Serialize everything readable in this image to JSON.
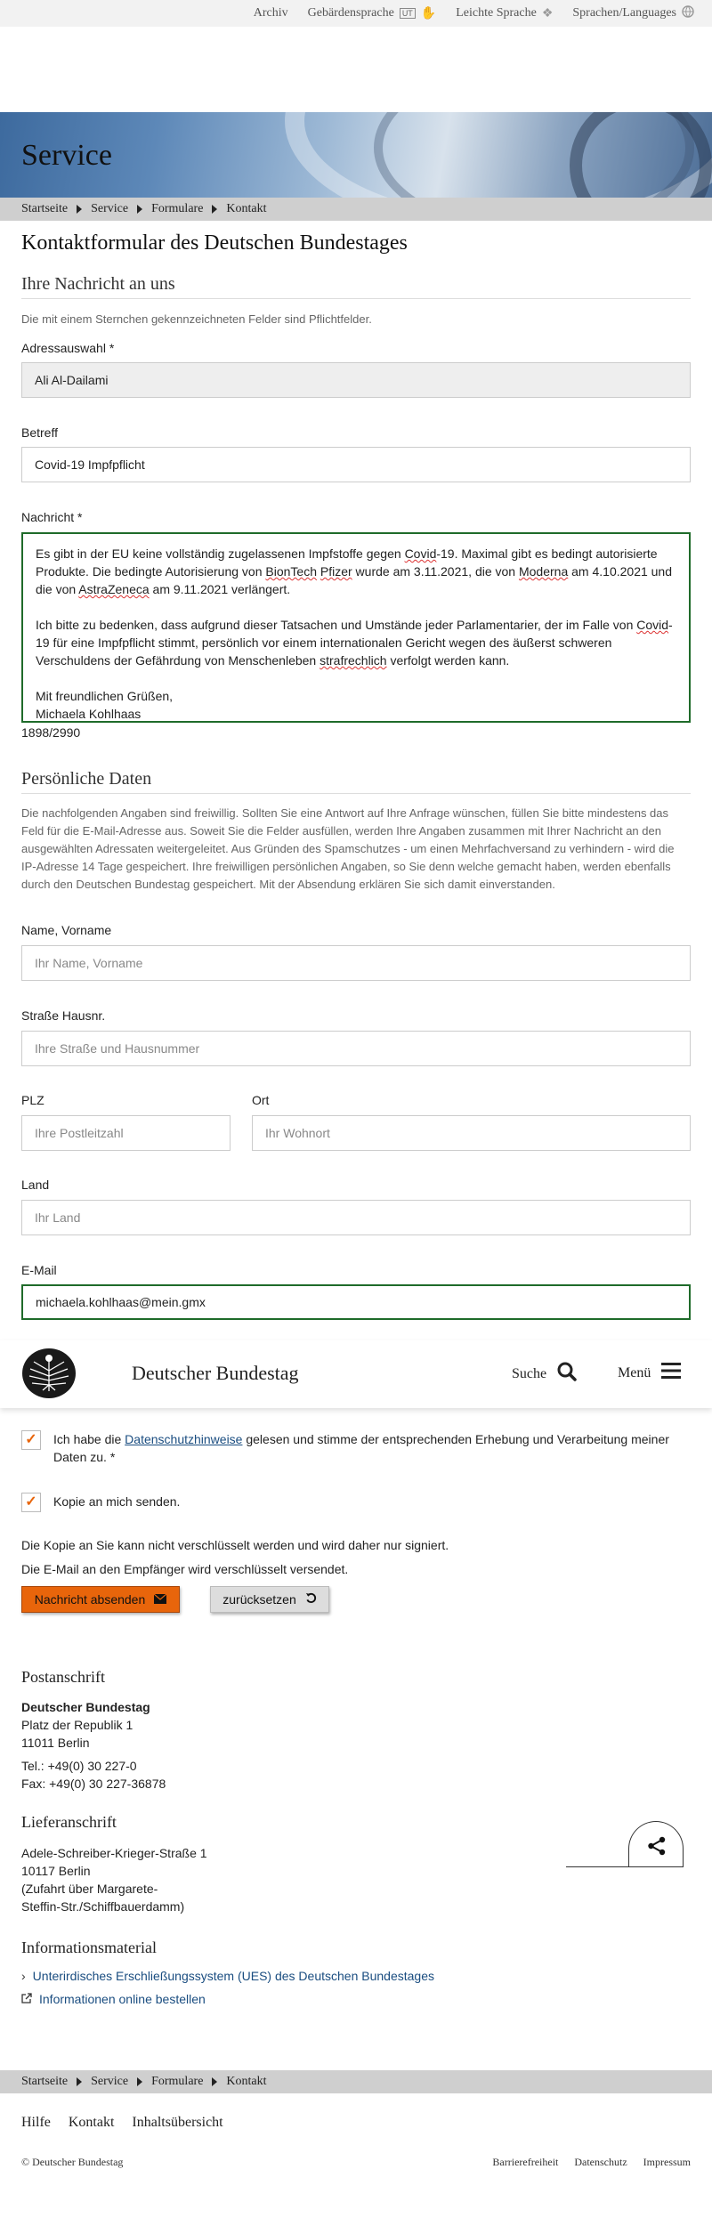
{
  "topbar": {
    "archiv": "Archiv",
    "gebaerdensprache": "Gebärdensprache",
    "gebaerden_badge": "UT",
    "leichte_sprache": "Leichte Sprache",
    "sprachen": "Sprachen/Languages"
  },
  "hero": {
    "title": "Service"
  },
  "breadcrumb": [
    "Startseite",
    "Service",
    "Formulare",
    "Kontakt"
  ],
  "page_title": "Kontaktformular des Deutschen Bundestages",
  "message_section": {
    "heading": "Ihre Nachricht an uns",
    "required_note": "Die mit einem Sternchen gekennzeichneten Felder sind Pflichtfelder.",
    "address_label": "Adressauswahl *",
    "address_value": "Ali Al-Dailami",
    "subject_label": "Betreff",
    "subject_value": "Covid-19 Impfpflicht",
    "message_label": "Nachricht *",
    "message_p1_a": "Es gibt in der EU keine vollständig zugelassenen Impfstoffe gegen ",
    "message_p1_b": "Covid",
    "message_p1_c": "-19. Maximal gibt es bedingt autorisierte Produkte. Die bedingte Autorisierung von ",
    "message_p1_d": "BionTech",
    "message_p1_e": " ",
    "message_p1_f": "Pfizer",
    "message_p1_g": " wurde am 3.11.2021, die von ",
    "message_p1_h": "Moderna",
    "message_p1_i": " am 4.10.2021 und die von ",
    "message_p1_j": "AstraZeneca",
    "message_p1_k": " am 9.11.2021 verlängert.",
    "message_p2_a": "Ich bitte zu bedenken, dass aufgrund dieser Tatsachen und Umstände jeder Parlamentarier, der im Falle von ",
    "message_p2_b": "Covid",
    "message_p2_c": "-19 für eine Impfpflicht stimmt, persönlich vor einem internationalen Gericht wegen des äußerst schweren Verschuldens der Gefährdung von Menschenleben ",
    "message_p2_d": "strafrechlich",
    "message_p2_e": " verfolgt werden kann.",
    "message_p3": "Mit freundlichen Grüßen,",
    "message_p4": "Michaela Kohlhaas",
    "counter": "1898/2990"
  },
  "personal_section": {
    "heading": "Persönliche Daten",
    "intro": "Die nachfolgenden Angaben sind freiwillig. Sollten Sie eine Antwort auf Ihre Anfrage wünschen, füllen Sie bitte mindestens das Feld für die E-Mail-Adresse aus. Soweit Sie die Felder ausfüllen, werden Ihre Angaben zusammen mit Ihrer Nachricht an den ausgewählten Adressaten weitergeleitet. Aus Gründen des Spamschutzes - um einen Mehrfachversand zu verhindern - wird die IP-Adresse 14 Tage gespeichert. Ihre freiwilligen persönlichen Angaben, so Sie denn welche gemacht haben, werden ebenfalls durch den Deutschen Bundestag gespeichert. Mit der Absendung erklären Sie sich damit einverstanden.",
    "name_label": "Name, Vorname",
    "name_placeholder": "Ihr Name, Vorname",
    "street_label": "Straße Hausnr.",
    "street_placeholder": "Ihre Straße und Hausnummer",
    "plz_label": "PLZ",
    "plz_placeholder": "Ihre Postleitzahl",
    "ort_label": "Ort",
    "ort_placeholder": "Ihr Wohnort",
    "land_label": "Land",
    "land_placeholder": "Ihr Land",
    "email_label": "E-Mail",
    "email_value": "michaela.kohlhaas@mein.gmx"
  },
  "sticky_header": {
    "title": "Deutscher Bundestag",
    "search": "Suche",
    "menu": "Menü"
  },
  "consent": {
    "privacy_a": "Ich habe die ",
    "privacy_link": "Datenschutzhinweise",
    "privacy_b": " gelesen und stimme der entsprechenden Erhebung und Verarbeitung meiner Daten zu. *",
    "copy_label": "Kopie an mich senden.",
    "note1": "Die Kopie an Sie kann nicht verschlüsselt werden und wird daher nur signiert.",
    "note2": "Die E-Mail an den Empfänger wird verschlüsselt versendet.",
    "submit": "Nachricht absenden",
    "reset": "zurücksetzen"
  },
  "footer_info": {
    "postanschrift_heading": "Postanschrift",
    "post_name": "Deutscher Bundestag",
    "post_street": "Platz der Republik 1",
    "post_city": "11011 Berlin",
    "tel": "Tel.: +49(0) 30 227-0",
    "fax": "Fax: +49(0) 30 227-36878",
    "lieferanschrift_heading": "Lieferanschrift",
    "lief_street": "Adele-Schreiber-Krieger-Straße 1",
    "lief_city": "10117 Berlin",
    "lief_note1": "(Zufahrt über Margarete-",
    "lief_note2": "Steffin-Str./Schiffbauerdamm)",
    "info_heading": "Informationsmaterial",
    "info_link1": "Unterirdisches Erschließungssystem (UES) des Deutschen Bundestages",
    "info_link2": "Informationen online bestellen"
  },
  "footer": {
    "nav": [
      "Hilfe",
      "Kontakt",
      "Inhaltsübersicht"
    ],
    "copyright": "© Deutscher Bundestag",
    "legal": [
      "Barrierefreiheit",
      "Datenschutz",
      "Impressum"
    ]
  },
  "colors": {
    "accent_orange": "#e8650b",
    "focus_green": "#1f6b2a",
    "link_blue": "#1a4d80",
    "breadcrumb_bg": "#cfcfcf"
  }
}
